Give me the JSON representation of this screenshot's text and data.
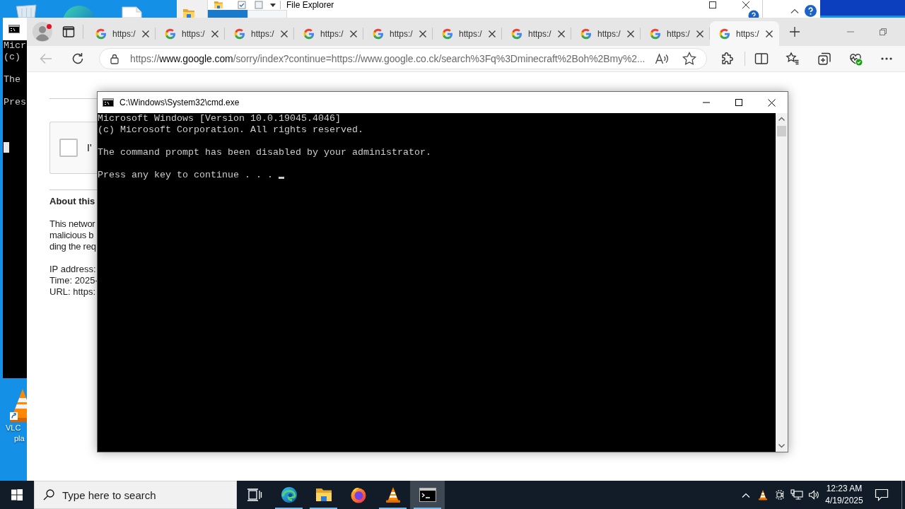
{
  "desktop": {
    "shortcuts": [
      {
        "kind": "vlc",
        "label_lines": [
          "VLC",
          "pla"
        ]
      }
    ]
  },
  "explorer_window": {
    "title": "File Explorer"
  },
  "console_behind": {
    "blocks": [
      [
        "Micr",
        "(c)"
      ],
      [
        "The"
      ],
      [
        "Pres"
      ]
    ],
    "cursor": true
  },
  "browser": {
    "tabs": [
      {
        "label": "https:/",
        "selected": false
      },
      {
        "label": "https:/",
        "selected": false
      },
      {
        "label": "https:/",
        "selected": false
      },
      {
        "label": "https:/",
        "selected": false
      },
      {
        "label": "https:/",
        "selected": false
      },
      {
        "label": "https:/",
        "selected": false
      },
      {
        "label": "https:/",
        "selected": false
      },
      {
        "label": "https:/",
        "selected": false
      },
      {
        "label": "https:/",
        "selected": false
      },
      {
        "label": "https:/",
        "selected": true
      }
    ],
    "back_disabled": true,
    "address": "https://**www.google.com**/sorry/index?continue=https://www.google.co.ck/search%3Fq%3Dminecraft%2Boh%2Bmy%2...",
    "page": {
      "captcha": {
        "label": "I'",
        "checked": false
      },
      "heading": "About this",
      "paragraph_lines": [
        "This networ",
        "malicious b",
        "ding the req"
      ],
      "details": [
        "IP address:",
        "Time: 2025-",
        "URL: https:"
      ]
    }
  },
  "console": {
    "title": "C:\\Windows\\System32\\cmd.exe",
    "blocks": [
      [
        "Microsoft Windows [Version 10.0.19045.4046]",
        "(c) Microsoft Corporation. All rights reserved."
      ],
      [
        "The command prompt has been disabled by your administrator."
      ],
      [
        "Press any key to continue . . ."
      ]
    ],
    "cursor": true
  },
  "taskbar": {
    "search": {
      "placeholder": "Type here to search"
    },
    "apps": [
      {
        "kind": "task_view",
        "running": false,
        "selected": false
      },
      {
        "kind": "edge",
        "running": true,
        "selected": false
      },
      {
        "kind": "explorer",
        "running": true,
        "selected": false
      },
      {
        "kind": "firefox",
        "running": false,
        "selected": false
      },
      {
        "kind": "vlc",
        "running": true,
        "selected": false
      },
      {
        "kind": "cmd",
        "running": true,
        "selected": true
      }
    ],
    "clock": {
      "time": "12:23 AM",
      "date": "4/19/2025"
    }
  }
}
